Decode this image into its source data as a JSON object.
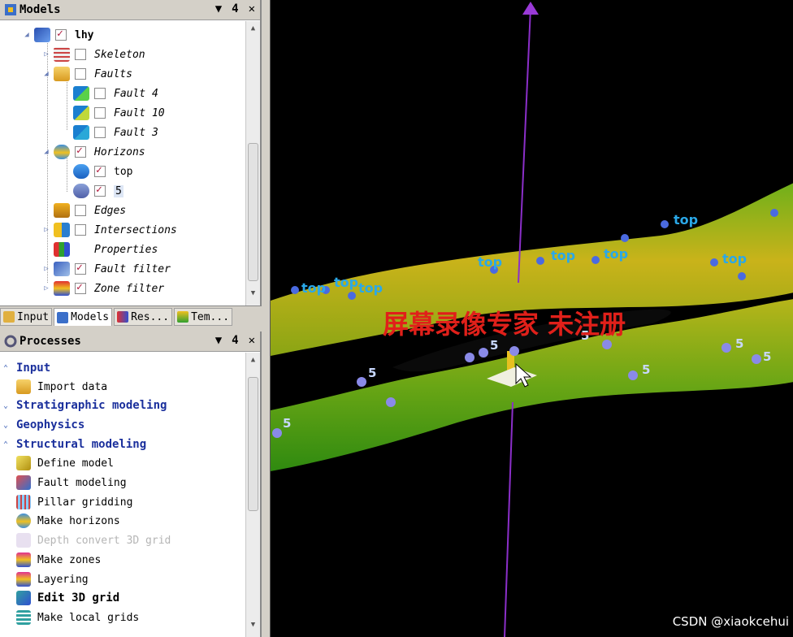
{
  "models_panel": {
    "title": "Models",
    "controls": [
      "▼",
      "4",
      "✕"
    ],
    "tree": [
      {
        "label": "lhy",
        "checked": true,
        "icon": "model-cube-icon"
      },
      {
        "label": "Skeleton",
        "checked": false,
        "icon": "grid-skeleton-icon"
      },
      {
        "label": "Faults",
        "checked": false,
        "icon": "faults-folder-icon"
      },
      {
        "label": "Fault 4",
        "checked": false,
        "icon": "fault-icon"
      },
      {
        "label": "Fault 10",
        "checked": false,
        "icon": "fault-icon"
      },
      {
        "label": "Fault 3",
        "checked": false,
        "icon": "fault-icon"
      },
      {
        "label": "Horizons",
        "checked": true,
        "icon": "horizons-icon"
      },
      {
        "label": "top",
        "checked": true,
        "icon": "horizon-surface-icon"
      },
      {
        "label": "5",
        "checked": true,
        "icon": "horizon-surface-icon"
      },
      {
        "label": "Edges",
        "checked": false,
        "icon": "edges-icon"
      },
      {
        "label": "Intersections",
        "checked": false,
        "icon": "intersections-icon"
      },
      {
        "label": "Properties",
        "icon": "properties-icon"
      },
      {
        "label": "Fault filter",
        "checked": true,
        "icon": "fault-filter-icon"
      },
      {
        "label": "Zone filter",
        "checked": true,
        "icon": "zone-filter-icon"
      }
    ]
  },
  "tabs": [
    "Input",
    "Models",
    "Res...",
    "Tem..."
  ],
  "processes_panel": {
    "title": "Processes",
    "controls": [
      "▼",
      "4",
      "✕"
    ],
    "items": [
      {
        "label": "Input",
        "type": "section",
        "expanded": true
      },
      {
        "label": "Import data",
        "type": "item"
      },
      {
        "label": "Stratigraphic modeling",
        "type": "section",
        "expanded": false
      },
      {
        "label": "Geophysics",
        "type": "section",
        "expanded": false
      },
      {
        "label": "Structural modeling",
        "type": "section",
        "expanded": true
      },
      {
        "label": "Define model",
        "type": "item"
      },
      {
        "label": "Fault modeling",
        "type": "item"
      },
      {
        "label": "Pillar gridding",
        "type": "item"
      },
      {
        "label": "Make horizons",
        "type": "item"
      },
      {
        "label": "Depth convert 3D grid",
        "type": "item",
        "disabled": true
      },
      {
        "label": "Make zones",
        "type": "item"
      },
      {
        "label": "Layering",
        "type": "item"
      },
      {
        "label": "Edit 3D grid",
        "type": "item",
        "strong": true
      },
      {
        "label": "Make local grids",
        "type": "item"
      }
    ]
  },
  "viewport": {
    "overlay_text": "屏幕录像专家 未注册",
    "surface_labels": [
      "top",
      "5"
    ],
    "watermark": "CSDN @xiaokcehui"
  },
  "colors": {
    "section_blue": "#1a2f9c",
    "surface_yellow": "#c9b31a",
    "surface_green": "#3f9a12",
    "well_purple": "#8b2fc9",
    "overlay_red": "#e0201a"
  }
}
